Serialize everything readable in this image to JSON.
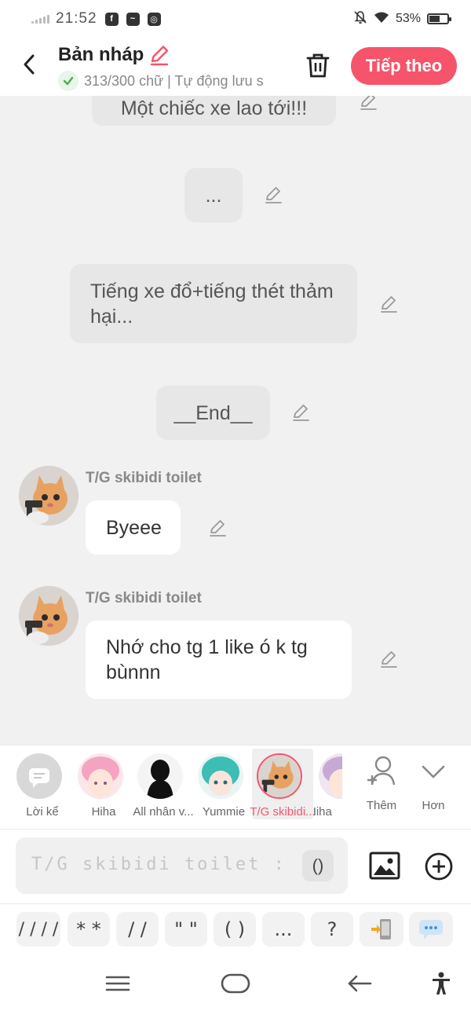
{
  "status_bar": {
    "time": "21:52",
    "battery": "53%"
  },
  "header": {
    "title": "Bản nháp",
    "subtitle": "313/300 chữ | Tự động lưu s",
    "next_label": "Tiếp theo"
  },
  "messages": {
    "m1": "Một chiếc xe lao tới!!!",
    "m2": "...",
    "m3": "Tiếng xe đổ+tiếng thét thảm hại...",
    "m4": "__End__",
    "name5": "T/G skibidi toilet",
    "m5": "Byeee",
    "name6": "T/G skibidi toilet",
    "m6": "Nhớ cho tg 1 like ó k tg bùnnn"
  },
  "characters": [
    {
      "label": "Lời kể"
    },
    {
      "label": "Hiha"
    },
    {
      "label": "All nhân v..."
    },
    {
      "label": "Yummie"
    },
    {
      "label": "T/G skibidi..."
    },
    {
      "label": "Hiha"
    }
  ],
  "bar_actions": {
    "more_label": "Thêm",
    "expand_label": "Hơn"
  },
  "composer": {
    "placeholder": "T/G skibidi toilet :",
    "paren": "()"
  },
  "quick_chips": [
    "/ / / /",
    "* *",
    "/ /",
    "\" \"",
    "( )",
    "..."
  ],
  "chip_question": "?",
  "colors": {
    "accent": "#f6546a",
    "bubble_narration": "#e7e7e7",
    "bubble_character": "#ffffff"
  }
}
